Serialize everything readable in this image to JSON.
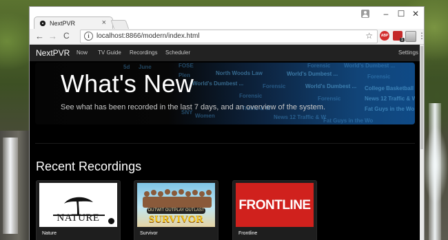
{
  "browser": {
    "tab_title": "NextPVR",
    "tab_close": "×",
    "url": "localhost:8866/modern/index.html",
    "window_controls": {
      "minimize": "–",
      "maximize": "☐",
      "close": "✕"
    },
    "nav": {
      "back": "←",
      "forward": "→",
      "reload": "C"
    },
    "info_icon": "i",
    "star": "☆",
    "menu": "⋮",
    "extensions": [
      {
        "name": "adblock-icon",
        "label": "ABP"
      },
      {
        "name": "notifications-extension-icon",
        "badge": "1"
      },
      {
        "name": "window-extension-icon"
      }
    ]
  },
  "app": {
    "brand": "NextPVR",
    "nav_items": [
      "Now",
      "TV Guide",
      "Recordings",
      "Scheduler"
    ],
    "settings": "Settings"
  },
  "hero": {
    "title": "What's New",
    "subtitle": "See what has been recorded in the last 7 days, and an overview of the system.",
    "guide_cells": [
      "5d",
      "June",
      "FOSE",
      "Plen",
      "North Woods Law",
      "Forensic",
      "World's Dumbest ...",
      "World's Dumbest ...",
      "Forensic",
      "World's Dumbest ...",
      "Forensic",
      "World's Dumbest ...",
      "Forensic",
      "College Basketball",
      "Forensic",
      "News 12 Traffic & W",
      "SNY",
      "Women",
      "News 12 Traffic & W",
      "Fat Guys in the Wo",
      "Traffic & W",
      "Fat Guys in the Wo"
    ]
  },
  "recent": {
    "heading": "Recent Recordings",
    "items": [
      {
        "title": "Nature",
        "art_text": "NATURE"
      },
      {
        "title": "Survivor",
        "art_text": "SURVIVOR",
        "art_tagline": "OUTWIT OUTPLAY OUTLAST"
      },
      {
        "title": "Frontline",
        "art_text": "FRONTLINE"
      }
    ]
  }
}
